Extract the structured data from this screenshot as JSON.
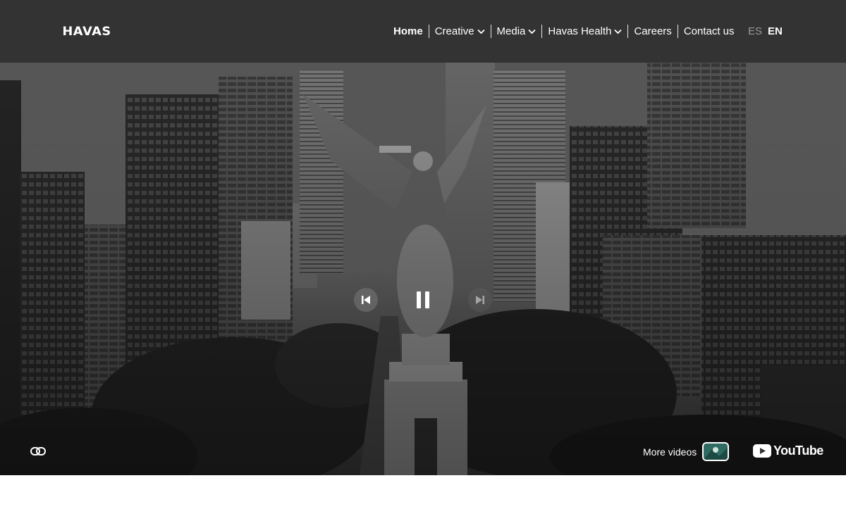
{
  "header": {
    "logo": "HAVAS",
    "nav": [
      {
        "label": "Home",
        "active": true,
        "dropdown": false
      },
      {
        "label": "Creative",
        "active": false,
        "dropdown": true
      },
      {
        "label": "Media",
        "active": false,
        "dropdown": true
      },
      {
        "label": "Havas Health",
        "active": false,
        "dropdown": true
      },
      {
        "label": "Careers",
        "active": false,
        "dropdown": false
      },
      {
        "label": "Contact us",
        "active": false,
        "dropdown": false
      }
    ],
    "lang": {
      "es": "ES",
      "en": "EN",
      "selected": "EN"
    }
  },
  "hero": {
    "video_state": "playing",
    "controls": [
      "previous-icon",
      "pause-icon",
      "next-icon"
    ],
    "bottom": {
      "link_icon": "link-icon",
      "more_videos_label": "More videos",
      "youtube_label": "YouTube"
    }
  },
  "colors": {
    "header_bg": "#333333",
    "text": "#ffffff",
    "inactive_lang": "#9a9a9a",
    "thumb_accent": "#2f6b63"
  }
}
